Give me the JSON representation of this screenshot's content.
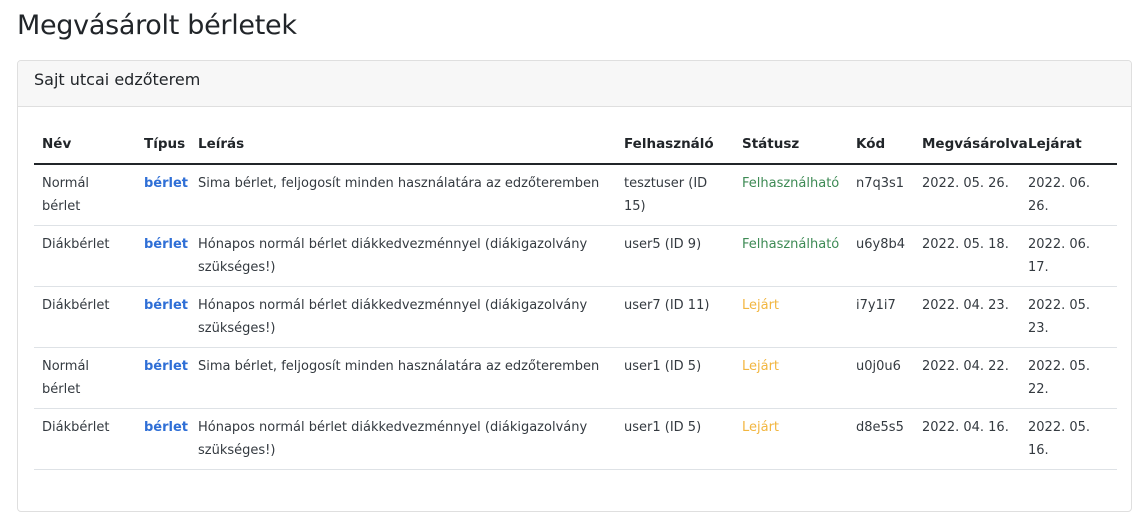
{
  "page": {
    "title": "Megvásárolt bérletek"
  },
  "card": {
    "header": "Sajt utcai edzőterem"
  },
  "colors": {
    "link": "#2f6fd6",
    "status_ok": "#3d8a54",
    "status_expired": "#f2b640"
  },
  "table": {
    "columns": [
      "Név",
      "Típus",
      "Leírás",
      "Felhasználó",
      "Státusz",
      "Kód",
      "Megvásárolva",
      "Lejárat"
    ],
    "rows": [
      {
        "name": "Normál bérlet",
        "type": "bérlet",
        "description": "Sima bérlet, feljogosít minden használatára az edzőteremben",
        "user": "tesztuser (ID 15)",
        "status": "Felhasználható",
        "status_kind": "ok",
        "code": "n7q3s1",
        "purchased": "2022. 05. 26.",
        "expires": "2022. 06. 26."
      },
      {
        "name": "Diákbérlet",
        "type": "bérlet",
        "description": "Hónapos normál bérlet diákkedvezménnyel (diákigazolvány szükséges!)",
        "user": "user5 (ID 9)",
        "status": "Felhasználható",
        "status_kind": "ok",
        "code": "u6y8b4",
        "purchased": "2022. 05. 18.",
        "expires": "2022. 06. 17."
      },
      {
        "name": "Diákbérlet",
        "type": "bérlet",
        "description": "Hónapos normál bérlet diákkedvezménnyel (diákigazolvány szükséges!)",
        "user": "user7 (ID 11)",
        "status": "Lejárt",
        "status_kind": "expired",
        "code": "i7y1i7",
        "purchased": "2022. 04. 23.",
        "expires": "2022. 05. 23."
      },
      {
        "name": "Normál bérlet",
        "type": "bérlet",
        "description": "Sima bérlet, feljogosít minden használatára az edzőteremben",
        "user": "user1 (ID 5)",
        "status": "Lejárt",
        "status_kind": "expired",
        "code": "u0j0u6",
        "purchased": "2022. 04. 22.",
        "expires": "2022. 05. 22."
      },
      {
        "name": "Diákbérlet",
        "type": "bérlet",
        "description": "Hónapos normál bérlet diákkedvezménnyel (diákigazolvány szükséges!)",
        "user": "user1 (ID 5)",
        "status": "Lejárt",
        "status_kind": "expired",
        "code": "d8e5s5",
        "purchased": "2022. 04. 16.",
        "expires": "2022. 05. 16."
      }
    ]
  }
}
